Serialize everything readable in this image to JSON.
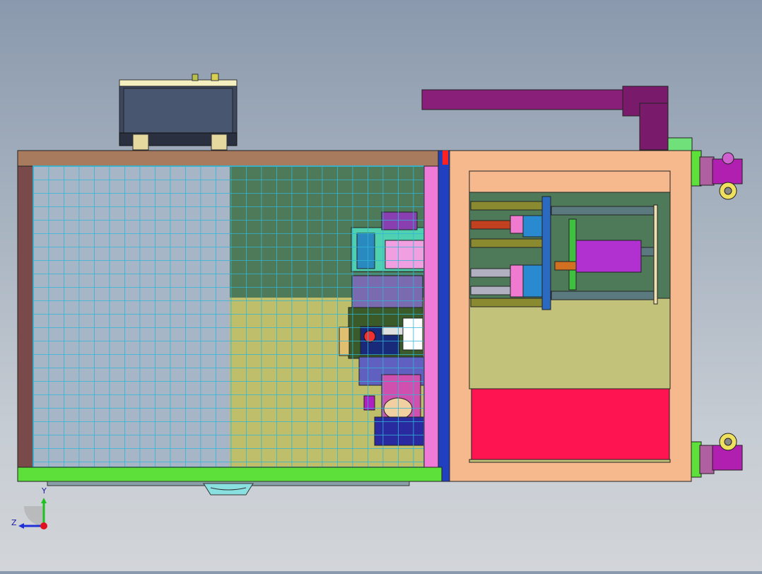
{
  "viewport": {
    "background_top": "#8a99ad",
    "background_bottom": "#d2d5d9"
  },
  "model": {
    "frame_color": "#a87a5e",
    "grid_color": "#2fb6d6",
    "cabinet_color": "#f6b98d",
    "green_rail_color": "#5ee03a",
    "pink_panel_color": "#f07ad8",
    "red_panel_color": "#ff1452",
    "olive_panel_color": "#c3c27a",
    "cylinder_color": "#8a1f7a",
    "caster_color": "#b01fb0"
  },
  "triad": {
    "y_label": "Y",
    "z_label": "Z",
    "y_axis_color": "#1fc11f",
    "z_axis_color": "#2030d8",
    "origin_color": "#e01020"
  }
}
